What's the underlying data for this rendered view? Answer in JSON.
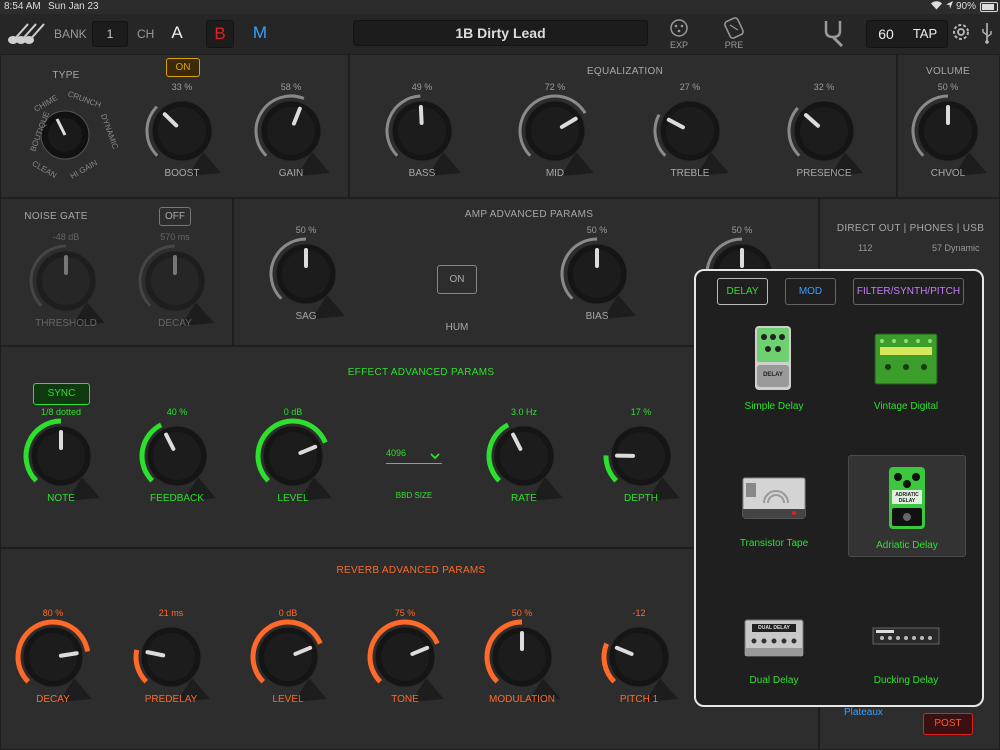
{
  "status": {
    "time": "8:54 AM",
    "date": "Sun Jan 23",
    "battery": "90%"
  },
  "topbar": {
    "bank_label": "BANK",
    "bank_value": "1",
    "ch_label": "CH",
    "ch_a": "A",
    "ch_b": "B",
    "ch_m": "M",
    "preset_name": "1B Dirty Lead",
    "exp_label": "EXP",
    "pre_label": "PRE",
    "tempo": "60",
    "tap_label": "TAP"
  },
  "amp": {
    "type_title": "TYPE",
    "type_labels": [
      "BOUTIQUE",
      "CHIME",
      "CRUNCH",
      "DYNAMIC",
      "HI GAIN",
      "CLEAN"
    ],
    "boost_toggle": "ON",
    "knobs": [
      {
        "label": "BOOST",
        "value": "33 %",
        "level": 0.33
      },
      {
        "label": "GAIN",
        "value": "58 %",
        "level": 0.58
      }
    ]
  },
  "eq": {
    "title": "EQUALIZATION",
    "knobs": [
      {
        "label": "BASS",
        "value": "49 %",
        "level": 0.49
      },
      {
        "label": "MID",
        "value": "72 %",
        "level": 0.72
      },
      {
        "label": "TREBLE",
        "value": "27 %",
        "level": 0.27
      },
      {
        "label": "PRESENCE",
        "value": "32 %",
        "level": 0.32
      }
    ]
  },
  "volume": {
    "title": "VOLUME",
    "knob": {
      "label": "CHVOL",
      "value": "50 %",
      "level": 0.5
    }
  },
  "noise_gate": {
    "title": "NOISE GATE",
    "toggle": "OFF",
    "knobs": [
      {
        "label": "THRESHOLD",
        "value": "-48 dB",
        "level": 0.5
      },
      {
        "label": "DECAY",
        "value": "570 ms",
        "level": 0.5
      }
    ]
  },
  "amp_adv": {
    "title": "AMP ADVANCED PARAMS",
    "knobs": [
      {
        "label": "SAG",
        "value": "50 %",
        "level": 0.5
      },
      {
        "label": "BIAS",
        "value": "50 %",
        "level": 0.5
      },
      {
        "label": "",
        "value": "50 %",
        "level": 0.5
      }
    ],
    "hum_label": "HUM",
    "hum_toggle": "ON"
  },
  "direct_out": {
    "title": "DIRECT OUT | PHONES | USB",
    "left_value": "112",
    "right_value": "57 Dynamic"
  },
  "effect_adv": {
    "title": "EFFECT ADVANCED PARAMS",
    "sync_label": "SYNC",
    "knobs": [
      {
        "label": "NOTE",
        "value": "1/8 dotted",
        "level": 0.5
      },
      {
        "label": "FEEDBACK",
        "value": "40 %",
        "level": 0.4
      },
      {
        "label": "LEVEL",
        "value": "0 dB",
        "level": 0.75
      },
      {
        "label": "RATE",
        "value": "3.0 Hz",
        "level": 0.4
      },
      {
        "label": "DEPTH",
        "value": "17 %",
        "level": 0.17
      }
    ],
    "bbd_value": "4096",
    "bbd_label": "BBD SIZE"
  },
  "reverb_adv": {
    "title": "REVERB ADVANCED PARAMS",
    "knobs": [
      {
        "label": "DECAY",
        "value": "80 %",
        "level": 0.8
      },
      {
        "label": "PREDELAY",
        "value": "21 ms",
        "level": 0.21
      },
      {
        "label": "LEVEL",
        "value": "0 dB",
        "level": 0.75
      },
      {
        "label": "TONE",
        "value": "75 %",
        "level": 0.75
      },
      {
        "label": "MODULATION",
        "value": "50 %",
        "level": 0.5
      },
      {
        "label": "PITCH 1",
        "value": "-12",
        "level": 0.25
      }
    ]
  },
  "bottom_right": {
    "plateaux": "Plateaux",
    "post": "POST"
  },
  "popup": {
    "tabs": [
      "DELAY",
      "MOD",
      "FILTER/SYNTH/PITCH"
    ],
    "pedals": [
      "Simple Delay",
      "Vintage Digital",
      "Transistor Tape",
      "Adriatic Delay",
      "Dual Delay",
      "Ducking Delay"
    ],
    "selected": "Adriatic Delay",
    "pedal_texts": {
      "simple": "DELAY",
      "adriatic": "ADRIATIC DELAY",
      "dual": "DUAL DELAY"
    }
  },
  "colors": {
    "green": "#2ee02e",
    "orange": "#ff6a2b",
    "blue": "#3aa0ff",
    "red": "#e02020",
    "amber": "#e0a000"
  }
}
